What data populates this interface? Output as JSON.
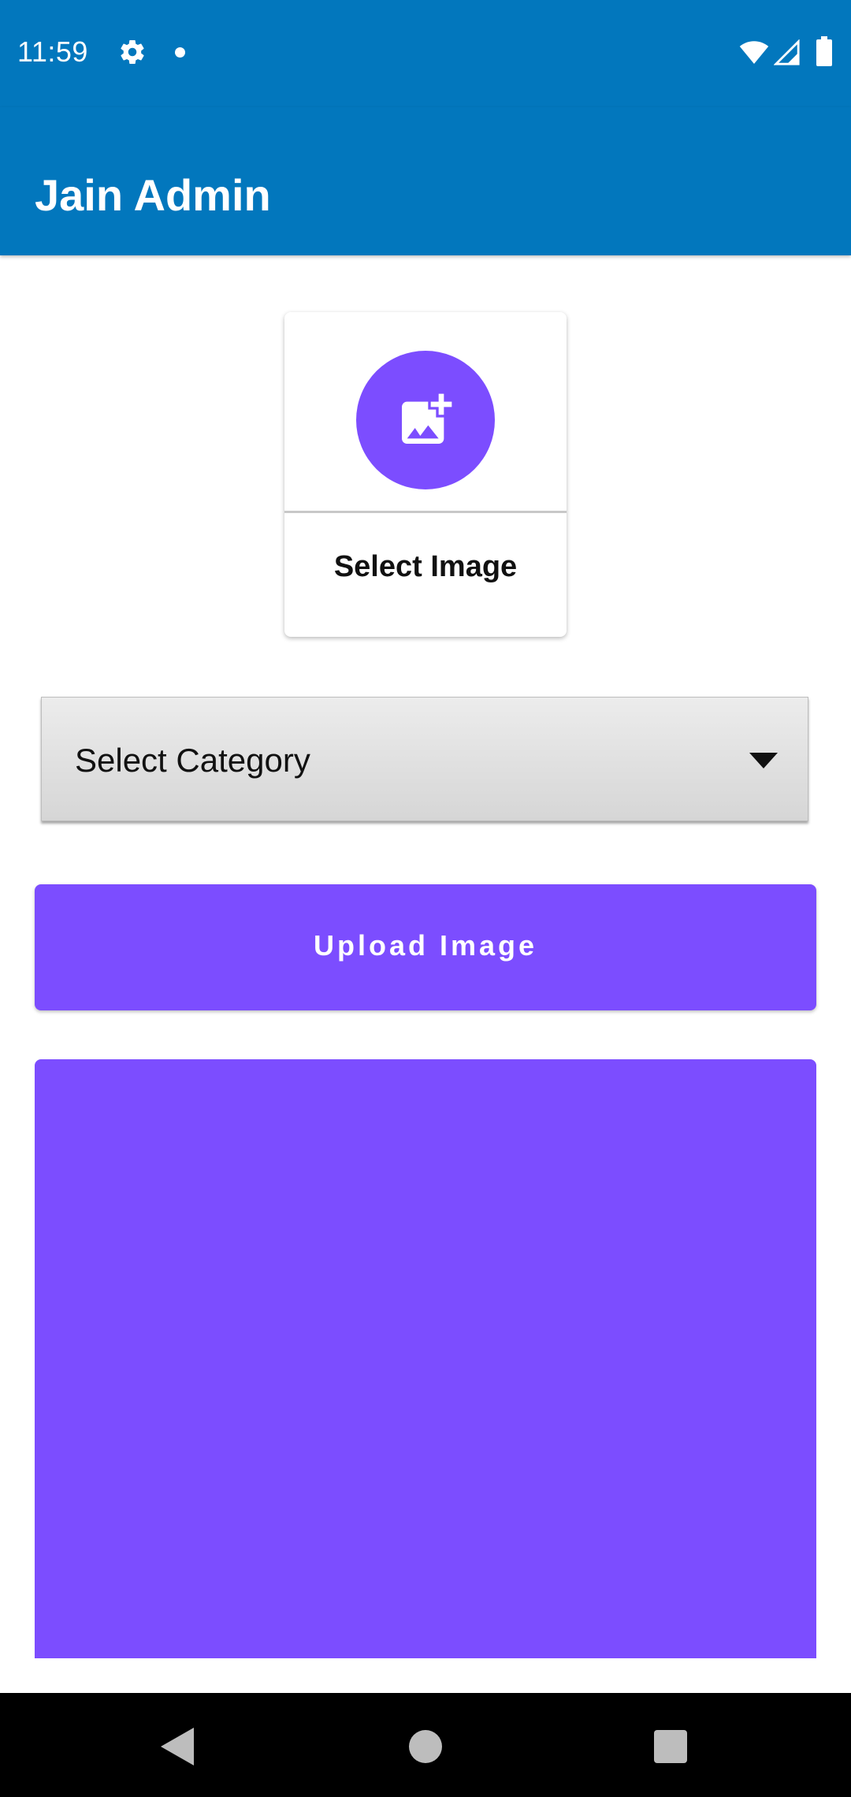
{
  "status_bar": {
    "time": "11:59",
    "icons": [
      "settings-gear-icon",
      "notification-dot-icon",
      "wifi-icon",
      "cellular-signal-icon",
      "battery-icon"
    ]
  },
  "app_bar": {
    "title": "Jain Admin",
    "color": "#0277bd"
  },
  "image_picker": {
    "icon": "add-photo-icon",
    "label": "Select Image",
    "accent": "#7c4dff"
  },
  "category_dropdown": {
    "selected": "Select Category",
    "icon": "dropdown-arrow-icon"
  },
  "upload_button": {
    "label": "Upload Image",
    "color": "#7c4dff"
  },
  "navigation_bar": {
    "icons": [
      "back-icon",
      "home-icon",
      "recents-icon"
    ]
  }
}
